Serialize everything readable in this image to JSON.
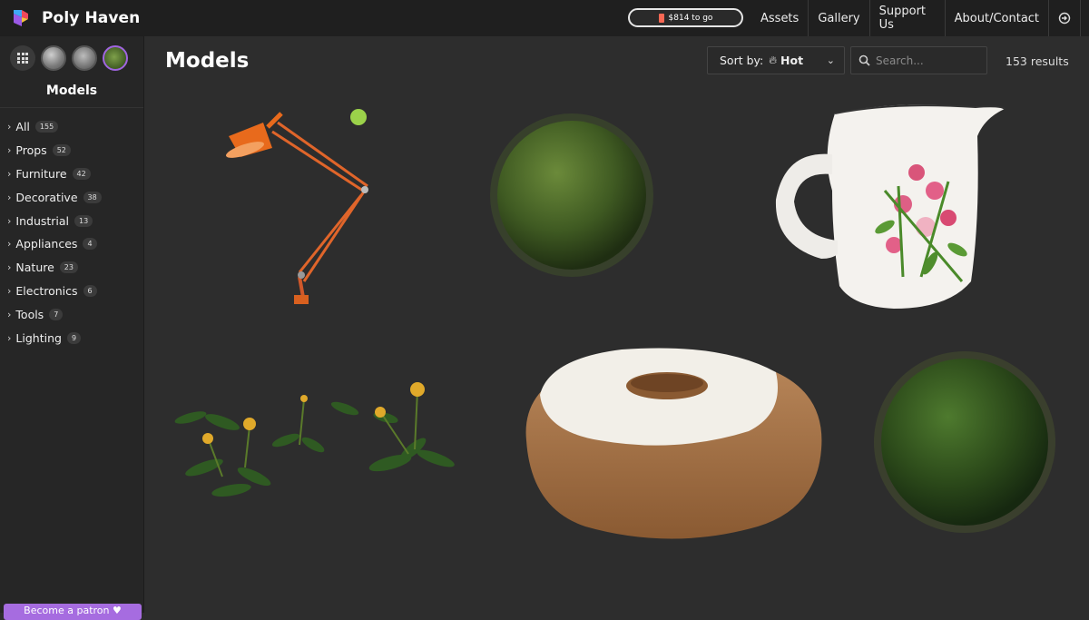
{
  "header": {
    "brand": "Poly Haven",
    "goal_text": "$814 to go",
    "nav": [
      "Assets",
      "Gallery",
      "Support Us",
      "About/Contact"
    ],
    "login_icon": "login-icon",
    "language_icon": "uk-flag-icon"
  },
  "sidebar": {
    "title": "Models",
    "type_buttons": [
      "all-types-icon",
      "hdri-icon",
      "texture-icon",
      "model-icon"
    ],
    "categories": [
      {
        "label": "All",
        "count": "155"
      },
      {
        "label": "Props",
        "count": "52"
      },
      {
        "label": "Furniture",
        "count": "42"
      },
      {
        "label": "Decorative",
        "count": "38"
      },
      {
        "label": "Industrial",
        "count": "13"
      },
      {
        "label": "Appliances",
        "count": "4"
      },
      {
        "label": "Nature",
        "count": "23"
      },
      {
        "label": "Electronics",
        "count": "6"
      },
      {
        "label": "Tools",
        "count": "7"
      },
      {
        "label": "Lighting",
        "count": "9"
      }
    ],
    "donate_label": "Become a patron ♥"
  },
  "main": {
    "title": "Models",
    "sort_label": "Sort by:",
    "sort_value": "Hot",
    "search_placeholder": "Search...",
    "results": "153 results",
    "assets": [
      "desk-lamp",
      "moss-ball",
      "ceramic-jug",
      "dandelions",
      "bundt-cake",
      "moss-ball-2"
    ]
  },
  "colors": {
    "bg": "#2d2d2d",
    "topbar": "#1f1f1f",
    "sidebar": "#262626",
    "accent_purple": "#a66ce0",
    "patreon_red": "#f96854"
  }
}
